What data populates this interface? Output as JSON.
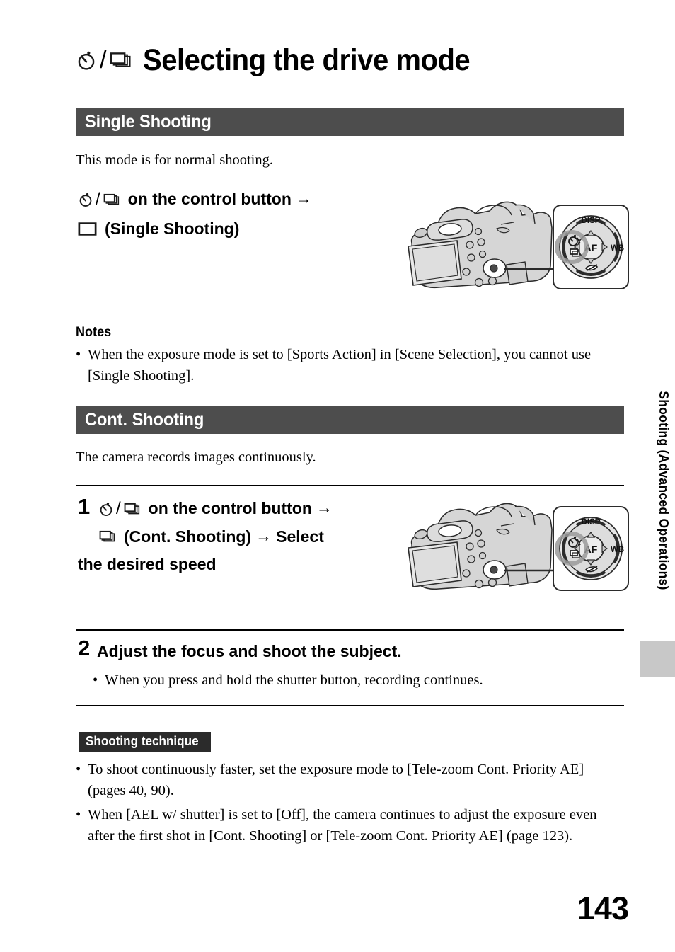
{
  "title": {
    "text": "Selecting the drive mode",
    "icons": [
      "self-timer-icon",
      "slash",
      "continuous-shooting-icon"
    ]
  },
  "sections": [
    {
      "heading": "Single Shooting",
      "intro": "This mode is for normal shooting.",
      "instruction": {
        "line1_prefix_icons": [
          "self-timer-icon",
          "slash",
          "continuous-shooting-icon"
        ],
        "line1": "on the control button",
        "arrow": "→",
        "line2_icon": "single-shooting-icon",
        "line2": "(Single Shooting)"
      },
      "notes_label": "Notes",
      "notes": [
        "When the exposure mode is set to [Sports Action] in [Scene Selection], you cannot use [Single Shooting]."
      ]
    },
    {
      "heading": "Cont. Shooting",
      "intro": "The camera records images continuously.",
      "steps": [
        {
          "number": "1",
          "line1": "on the control button",
          "arrow": "→",
          "line2": "(Cont. Shooting)",
          "line2_tail": "Select",
          "line3": "the desired speed"
        },
        {
          "number": "2",
          "text": "Adjust the focus and shoot the subject.",
          "bullets": [
            "When you press and hold the shutter button, recording continues."
          ]
        }
      ],
      "technique": {
        "label": "Shooting technique",
        "bullets": [
          "To shoot continuously faster, set the exposure mode to [Tele-zoom Cont. Priority AE] (pages 40, 90).",
          "When [AEL w/ shutter] is set to [Off], the camera continues to adjust the exposure even after the first shot in [Cont. Shooting] or [Tele-zoom Cont. Priority AE] (page 123)."
        ]
      }
    }
  ],
  "illustration": {
    "dial_labels": {
      "top": "DISP",
      "center": "AF",
      "right": "WB"
    }
  },
  "side_tab": {
    "label": "Shooting (Advanced Operations)",
    "block_color": "#c8c8c8"
  },
  "page_number": "143",
  "colors": {
    "section_bar": "#4d4d4d",
    "badge": "#2b2b2b",
    "camera_body": "#d4d4d4",
    "text": "#000000"
  }
}
